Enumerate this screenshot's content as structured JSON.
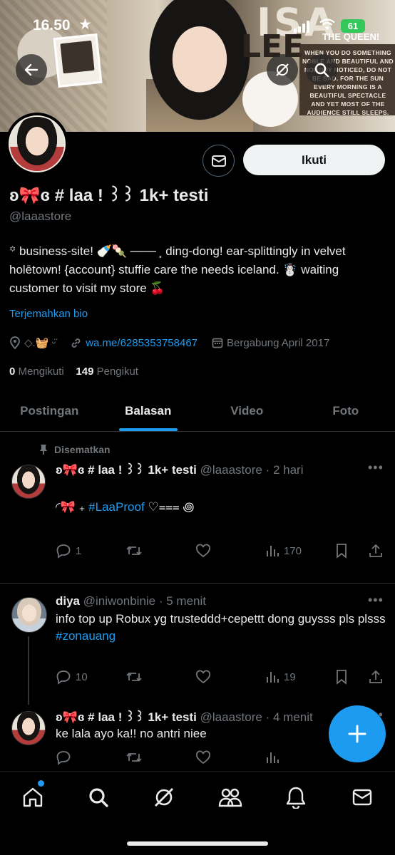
{
  "status_bar": {
    "time": "16.50",
    "battery": "61"
  },
  "banner": {
    "title_top": "ISA",
    "title_bottom": "LEE",
    "queen": "THE QUEEN!",
    "card_text": "WHEN YOU DO SOMETHING NOBLE AND BEAUTIFUL AND NOBODY NOTICED, DO NOT BE SAD. FOR THE SUN EVERY MORNING IS A BEAUTIFUL SPECTACLE AND YET MOST OF THE AUDIENCE STILL SLEEPS."
  },
  "profile": {
    "follow_label": "Ikuti",
    "display_name": "ʚ🎀ɞ # laa ! ꒱꒱ 1k+ testi",
    "handle": "@laaastore",
    "bio": "꙳ business-site! 🍼🍡 ─── ⸼ ding-dong! ear-splittingly in velvet holētown! {account} stuffie care the needs iceland. ☃️ waiting customer to visit my store 🍒",
    "translate_label": "Terjemahkan bio",
    "location": "◇.🧺 ᵕ̈",
    "link": "wa.me/6285353758467",
    "joined": "Bergabung April 2017",
    "following_count": "0",
    "following_label": "Mengikuti",
    "followers_count": "149",
    "followers_label": "Pengikut"
  },
  "tabs": [
    {
      "label": "Postingan"
    },
    {
      "label": "Balasan"
    },
    {
      "label": "Video"
    },
    {
      "label": "Foto"
    }
  ],
  "posts": [
    {
      "pinned_label": "Disematkan",
      "name": "ʚ🎀ɞ # laa ! ꒱꒱ 1k+ testi",
      "handle": "@laaastore",
      "time": "· 2 hari",
      "text_prefix": "◜🎀 ₊ ",
      "hashtag": "#LaaProof",
      "text_suffix": " ♡⩶ ꩜",
      "replies": "1",
      "views": "170"
    },
    {
      "name": "diya",
      "handle": "@iniwonbinie",
      "time": "· 5 menit",
      "text": "info top up Robux yg trusteddd+cepettt dong guysss pls plsss",
      "hashtag": "#zonauang",
      "replies": "10",
      "views": "19"
    },
    {
      "name": "ʚ🎀ɞ # laa ! ꒱꒱ 1k+ testi",
      "handle": "@laaastore",
      "time": "· 4 menit",
      "text": "ke lala ayo ka!! no antri niee"
    }
  ],
  "colors": {
    "accent": "#1d9bf0",
    "muted": "#71767b",
    "text": "#e7e9ea",
    "divider": "#2f3336"
  }
}
